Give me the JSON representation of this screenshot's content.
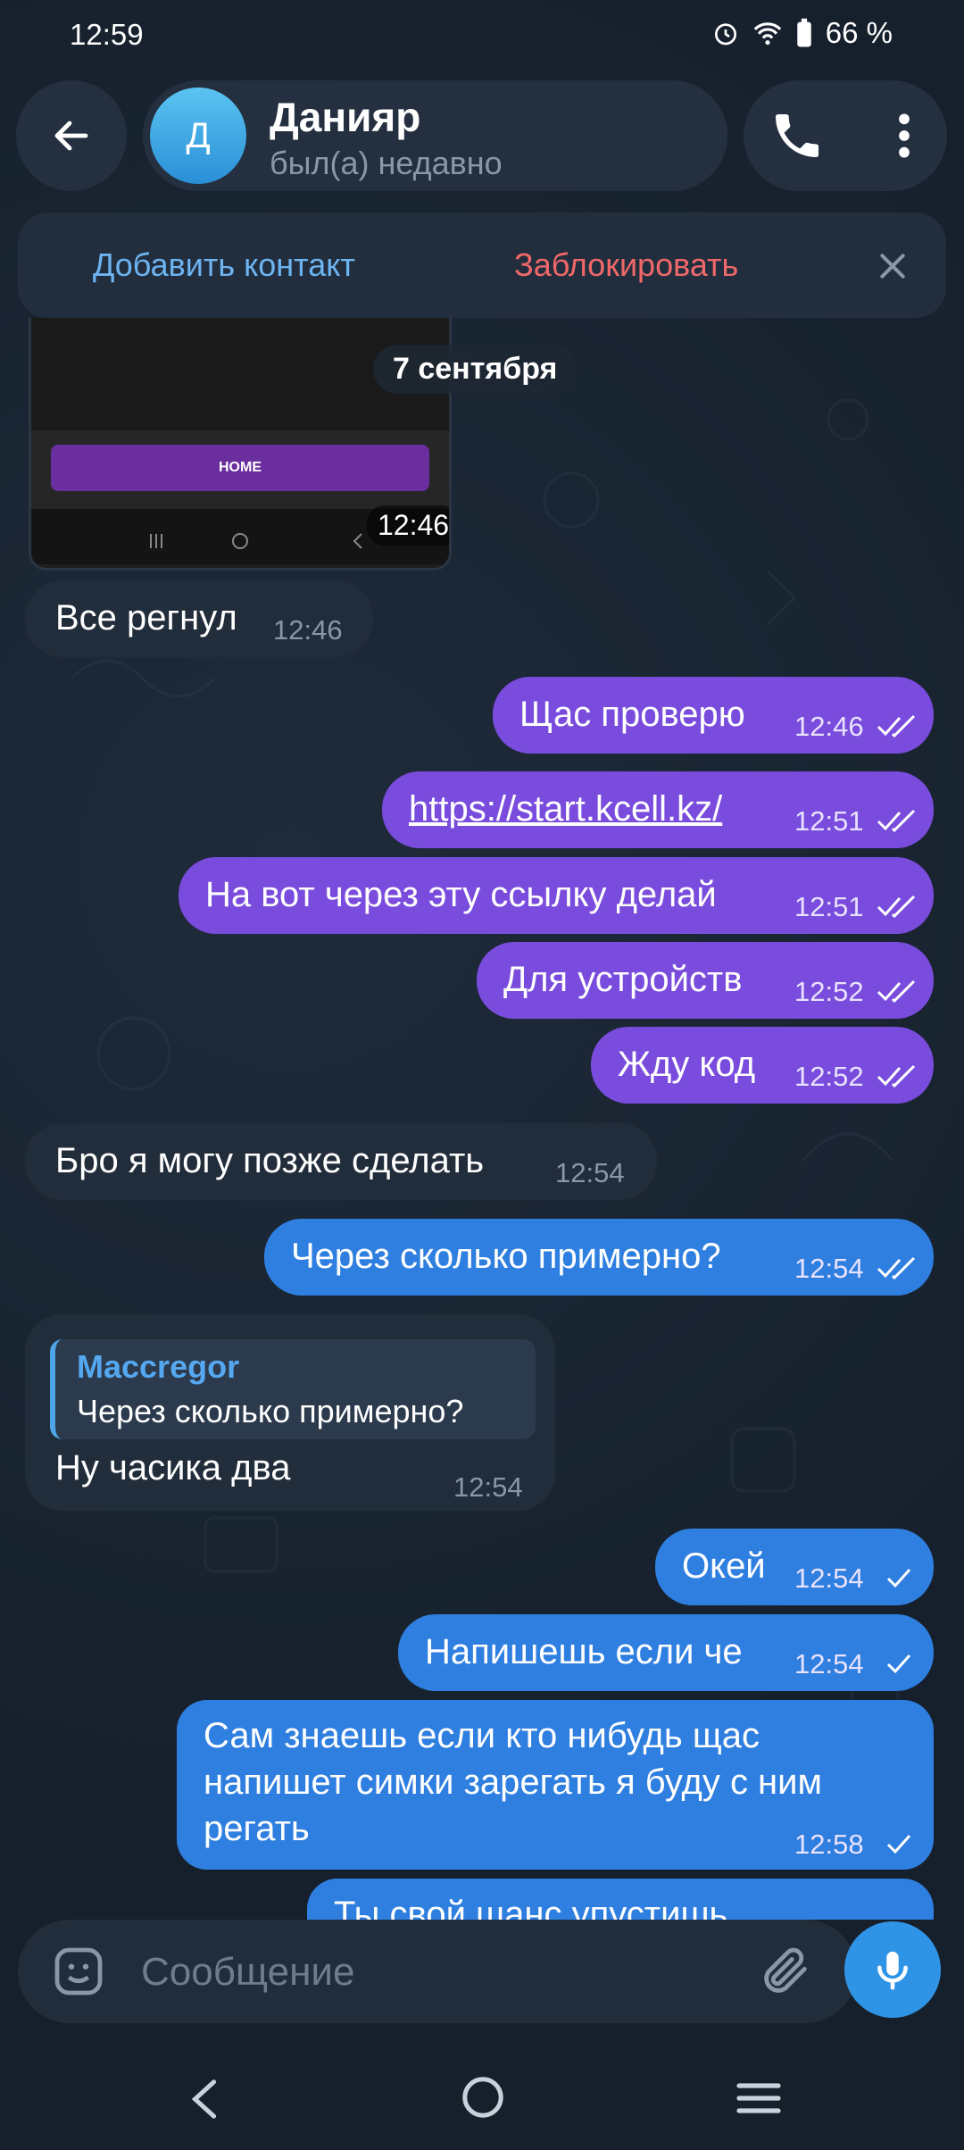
{
  "status_bar": {
    "time": "12:59",
    "battery": "66 %"
  },
  "header": {
    "back_icon": "arrow-left-icon",
    "avatar_letter": "Д",
    "name": "Данияр",
    "status": "был(а) недавно",
    "call_icon": "phone-icon",
    "menu_icon": "more-vertical-icon"
  },
  "action_bar": {
    "add_contact": "Добавить контакт",
    "block": "Заблокировать",
    "close_icon": "close-icon"
  },
  "date_separator": "7 сентября",
  "image_message": {
    "button_label": "HOME",
    "time": "12:46"
  },
  "messages": [
    {
      "dir": "in",
      "text": "Все регнул",
      "time": "12:46"
    },
    {
      "dir": "out",
      "text": "Щас проверю",
      "time": "12:46",
      "status": "read"
    },
    {
      "dir": "out",
      "text": "https://start.kcell.kz/",
      "time": "12:51",
      "status": "read"
    },
    {
      "dir": "out",
      "text": "На вот через эту ссылку делай",
      "time": "12:51",
      "status": "read"
    },
    {
      "dir": "out",
      "text": "Для устройств",
      "time": "12:52",
      "status": "read"
    },
    {
      "dir": "out",
      "text": "Жду код",
      "time": "12:52",
      "status": "read"
    },
    {
      "dir": "in",
      "text": "Бро я могу позже сделать",
      "time": "12:54"
    },
    {
      "dir": "out",
      "text": "Через сколько примерно?",
      "time": "12:54",
      "status": "read"
    },
    {
      "dir": "in",
      "text": "Ну часика два",
      "time": "12:54",
      "reply_name": "Maccregor",
      "reply_text": "Через сколько примерно?"
    },
    {
      "dir": "out",
      "text": "Окей",
      "time": "12:54",
      "status": "sent"
    },
    {
      "dir": "out",
      "text": "Напишешь если че",
      "time": "12:54",
      "status": "sent"
    },
    {
      "dir": "out",
      "text_lines": [
        "Сам знаешь если кто нибудь щас",
        "напишет симки зарегать я буду с ним",
        "регать"
      ],
      "time": "12:58",
      "status": "sent"
    },
    {
      "dir": "out",
      "text": "Ты свой шанс упустишь",
      "time": "",
      "status": "sent"
    }
  ],
  "composer": {
    "placeholder": "Сообщение",
    "sticker_icon": "sticker-icon",
    "attach_icon": "paperclip-icon",
    "mic_icon": "microphone-icon"
  },
  "system_nav": {
    "back": "nav-back-icon",
    "home": "nav-home-icon",
    "recents": "nav-recents-icon"
  }
}
